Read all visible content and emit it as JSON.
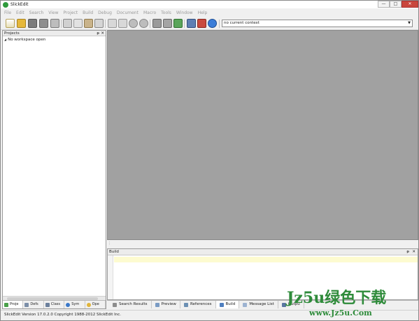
{
  "window": {
    "title": "SlickEdit",
    "minimize": "—",
    "maximize": "□",
    "close": "✕"
  },
  "menu": [
    "File",
    "Edit",
    "Search",
    "View",
    "Project",
    "Build",
    "Debug",
    "Document",
    "Macro",
    "Tools",
    "Window",
    "Help"
  ],
  "toolbar": {
    "context_value": "no current context",
    "icons": [
      "new-file",
      "open-folder",
      "save",
      "save-all",
      "print",
      "cut",
      "copy",
      "paste",
      "toggle-panel",
      "undo",
      "redo",
      "back",
      "forward",
      "bookmark",
      "find-references",
      "build",
      "debug",
      "tools",
      "help"
    ]
  },
  "projects_panel": {
    "title": "Projects",
    "pin": "ᵽ",
    "close": "✕",
    "tree_item": "No workspace open",
    "tabs": [
      "Proje",
      "Defs",
      "Class",
      "Sym",
      "Ope"
    ]
  },
  "build_panel": {
    "title": "Build",
    "pin": "ᵽ",
    "close": "✕",
    "tabs": [
      "Search Results",
      "Preview",
      "References",
      "Build",
      "Message List",
      "Outpu"
    ],
    "active_tab": "Build"
  },
  "status": {
    "text": "SlickEdit Version 17.0.2.0 Copyright 1988-2012 SlickEdit Inc."
  },
  "watermark": {
    "line1": "Jz5u绿色下载",
    "line2": "www.Jz5u.Com"
  },
  "colors": {
    "editor_bg": "#a1a1a1",
    "build_highlight": "#fdfbd0",
    "watermark_green": "#2e8b3a"
  }
}
